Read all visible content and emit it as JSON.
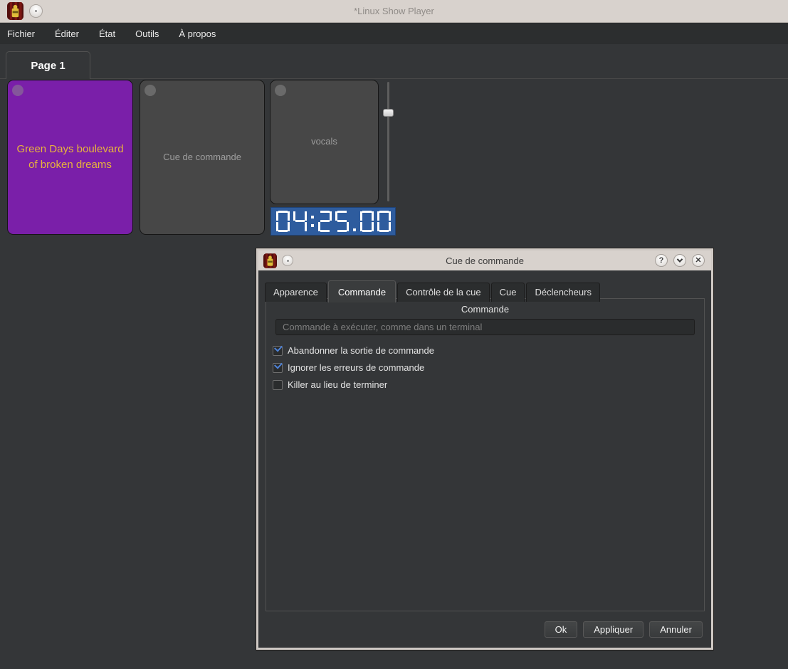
{
  "window": {
    "title": "*Linux Show Player",
    "menu": [
      "Fichier",
      "Éditer",
      "État",
      "Outils",
      "À propos"
    ],
    "page_tab": "Page 1"
  },
  "cues": [
    {
      "name": "Green Days boulevard of broken dreams",
      "bg": "#7a1fa9",
      "fg": "#e8b43c"
    },
    {
      "name": "Cue de commande",
      "bg": "#474747",
      "fg": "#9e9e9e"
    },
    {
      "name": "vocals",
      "bg": "#474747",
      "fg": "#9e9e9e"
    }
  ],
  "timer": {
    "value": "04:25.00",
    "bg": "#2e5c9e"
  },
  "dialog": {
    "title": "Cue de commande",
    "tabs": [
      "Apparence",
      "Commande",
      "Contrôle de la cue",
      "Cue",
      "Déclencheurs"
    ],
    "active_tab": "Commande",
    "group_label": "Commande",
    "command_input": {
      "value": "",
      "placeholder": "Commande à exécuter, comme dans un terminal"
    },
    "checkboxes": [
      {
        "label": "Abandonner la sortie de commande",
        "checked": true
      },
      {
        "label": "Ignorer les erreurs de commande",
        "checked": true
      },
      {
        "label": "Killer au lieu de terminer",
        "checked": false
      }
    ],
    "buttons": {
      "ok": "Ok",
      "apply": "Appliquer",
      "cancel": "Annuler"
    },
    "window_controls": {
      "help": "?",
      "close": "✕"
    }
  }
}
